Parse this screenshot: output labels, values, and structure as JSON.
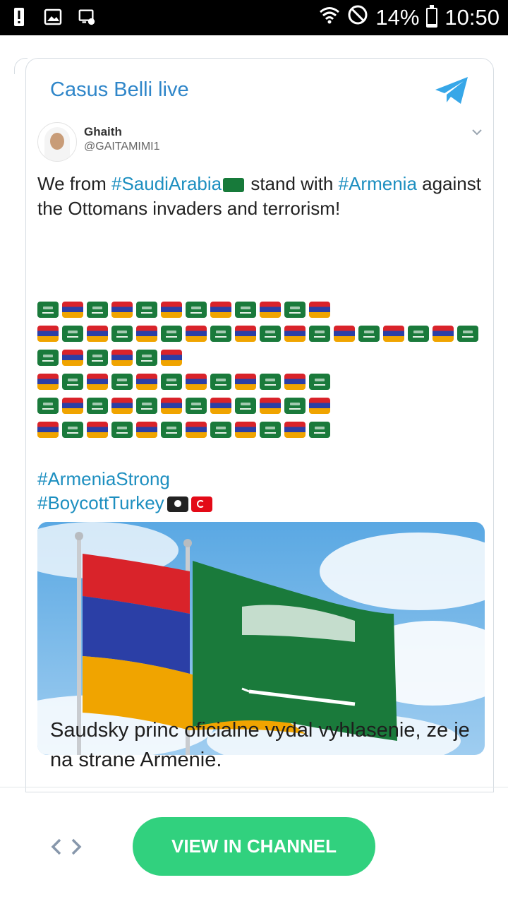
{
  "status_bar": {
    "left_icons": [
      "alert-icon",
      "image-icon",
      "cast-icon"
    ],
    "battery_percent": "14%",
    "battery_level": 0.14,
    "time": "10:50"
  },
  "card": {
    "channel_title": "Casus Belli live",
    "tweet": {
      "name": "Ghaith",
      "handle": "@GAITAMIMI1",
      "text_parts": {
        "p1": "We from ",
        "tag1": "#SaudiArabia",
        "p2": " stand with ",
        "tag2": "#Armenia",
        "p3": " against the Ottomans invaders and terrorism!"
      },
      "flag_rows": [
        [
          "sa",
          "am",
          "sa",
          "am",
          "sa",
          "am",
          "sa",
          "am",
          "sa",
          "am",
          "sa",
          "am"
        ],
        [
          "am",
          "sa",
          "am",
          "sa",
          "am",
          "sa",
          "am",
          "sa",
          "am",
          "sa",
          "am",
          "sa",
          "am",
          "sa",
          "am",
          "sa",
          "am",
          "sa"
        ],
        [
          "sa",
          "am",
          "sa",
          "am",
          "sa",
          "am"
        ],
        [
          "am",
          "sa",
          "am",
          "sa",
          "am",
          "sa",
          "am",
          "sa",
          "am",
          "sa",
          "am",
          "sa"
        ],
        [
          "sa",
          "am",
          "sa",
          "am",
          "sa",
          "am",
          "sa",
          "am",
          "sa",
          "am",
          "sa",
          "am"
        ],
        [
          "am",
          "sa",
          "am",
          "sa",
          "am",
          "sa",
          "am",
          "sa",
          "am",
          "sa",
          "am",
          "sa"
        ]
      ],
      "hashtag_1": "#ArmeniaStrong",
      "hashtag_2": "#BoycottTurkey",
      "photo_alt": "Armenia and Saudi Arabia flags",
      "colors": {
        "armenia_red": "#d9232a",
        "armenia_blue": "#2b3fa6",
        "armenia_orange": "#f0a400",
        "saudi_green": "#1a7a3b"
      }
    },
    "caption": "Saudsky princ oficialne vydal vyhlasenie, ze je na strane Armenie."
  },
  "bottom": {
    "code_icon": "code-icon",
    "view_button_label": "VIEW IN CHANNEL",
    "accent_color": "#31d17e"
  }
}
